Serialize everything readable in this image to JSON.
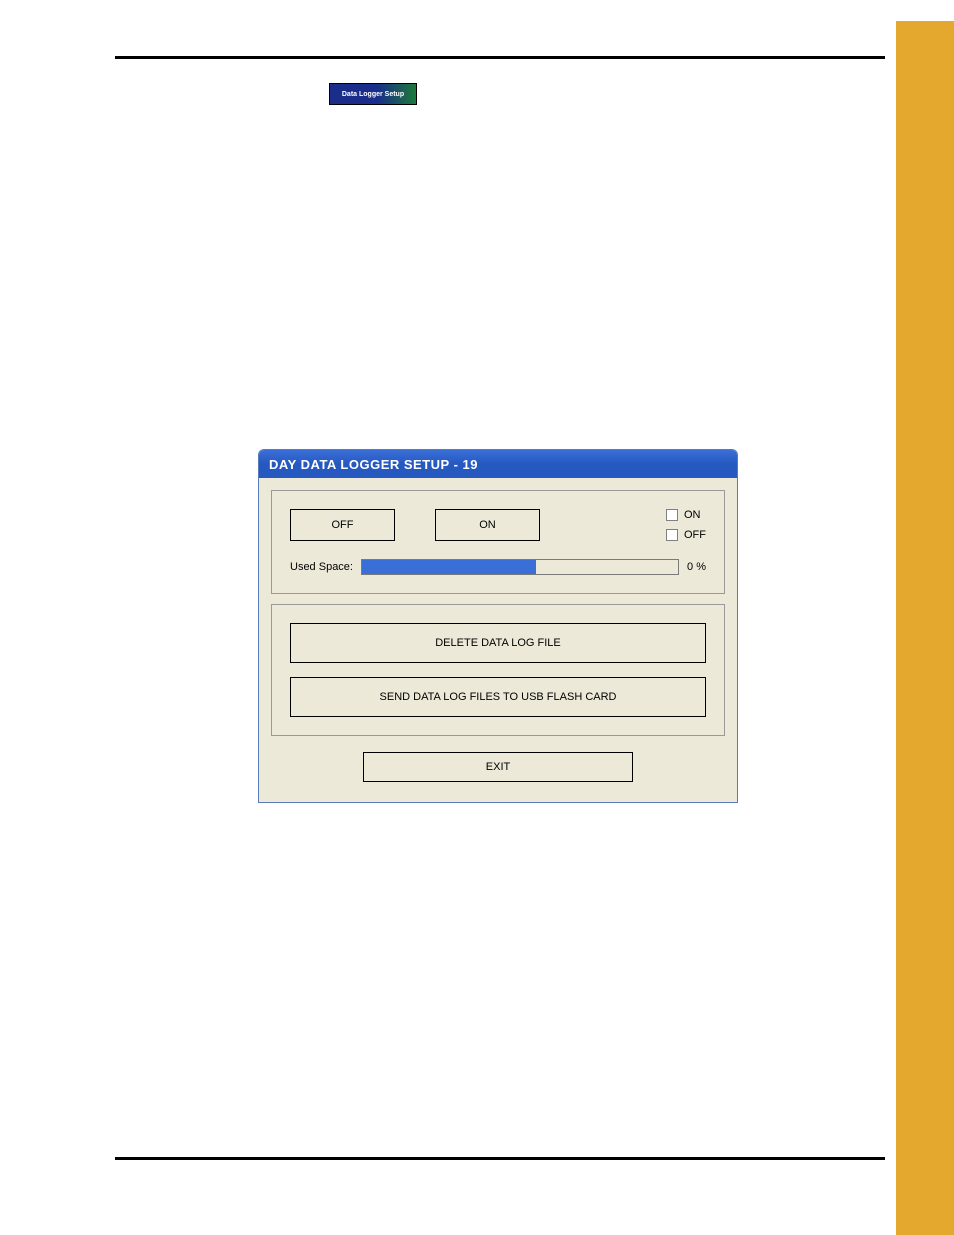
{
  "smallButton": {
    "label": "Data Logger Setup"
  },
  "dialog": {
    "title": "DAY DATA LOGGER SETUP - 19",
    "offButton": "OFF",
    "onButton": "ON",
    "onCheckLabel": "ON",
    "offCheckLabel": "OFF",
    "usedSpaceLabel": "Used Space:",
    "usedSpacePercent": "0 %",
    "deleteButton": "DELETE DATA LOG FILE",
    "sendButton": "SEND DATA LOG FILES TO USB FLASH CARD",
    "exitButton": "EXIT"
  }
}
